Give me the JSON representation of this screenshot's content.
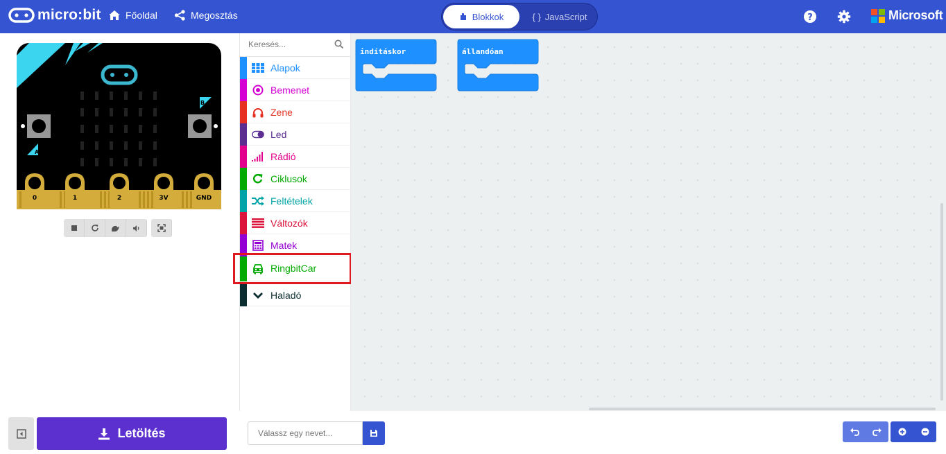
{
  "header": {
    "logo_text": "micro:bit",
    "home_label": "Főoldal",
    "share_label": "Megosztás",
    "blocks_label": "Blokkok",
    "js_label": "JavaScript",
    "js_braces": "{ }",
    "microsoft_label": "Microsoft",
    "brand_color": "#3454d1"
  },
  "simulator": {
    "pin_labels": [
      "0",
      "1",
      "2",
      "3V",
      "GND"
    ],
    "button_a": "A",
    "button_b": "B",
    "controls": [
      "stop-icon",
      "restart-icon",
      "slowmo-icon",
      "mute-icon",
      "fullscreen-icon"
    ]
  },
  "toolbox": {
    "search_placeholder": "Keresés...",
    "categories": [
      {
        "label": "Alapok",
        "color": "#1e90ff",
        "icon": "grid-icon"
      },
      {
        "label": "Bemenet",
        "color": "#d400d4",
        "icon": "target-icon"
      },
      {
        "label": "Zene",
        "color": "#e63022",
        "icon": "headphones-icon"
      },
      {
        "label": "Led",
        "color": "#5c2d91",
        "icon": "toggle-icon"
      },
      {
        "label": "Rádió",
        "color": "#e3008c",
        "icon": "signal-icon"
      },
      {
        "label": "Ciklusok",
        "color": "#00aa00",
        "icon": "refresh-icon"
      },
      {
        "label": "Feltételek",
        "color": "#00a4a6",
        "icon": "shuffle-icon"
      },
      {
        "label": "Változók",
        "color": "#dc143c",
        "icon": "list-icon"
      },
      {
        "label": "Matek",
        "color": "#9400d3",
        "icon": "calculator-icon"
      },
      {
        "label": "RingbitCar",
        "color": "#00aa00",
        "icon": "car-icon"
      },
      {
        "label": "Haladó",
        "color": "#0c2d30",
        "icon": "chevron-down-icon"
      }
    ]
  },
  "workspace": {
    "blocks": [
      {
        "label": "indításkor",
        "color": "#1e90ff"
      },
      {
        "label": "állandóan",
        "color": "#1e90ff"
      }
    ]
  },
  "bottom": {
    "download_label": "Letöltés",
    "name_placeholder": "Válassz egy nevet...",
    "download_color": "#5c2fcf"
  }
}
